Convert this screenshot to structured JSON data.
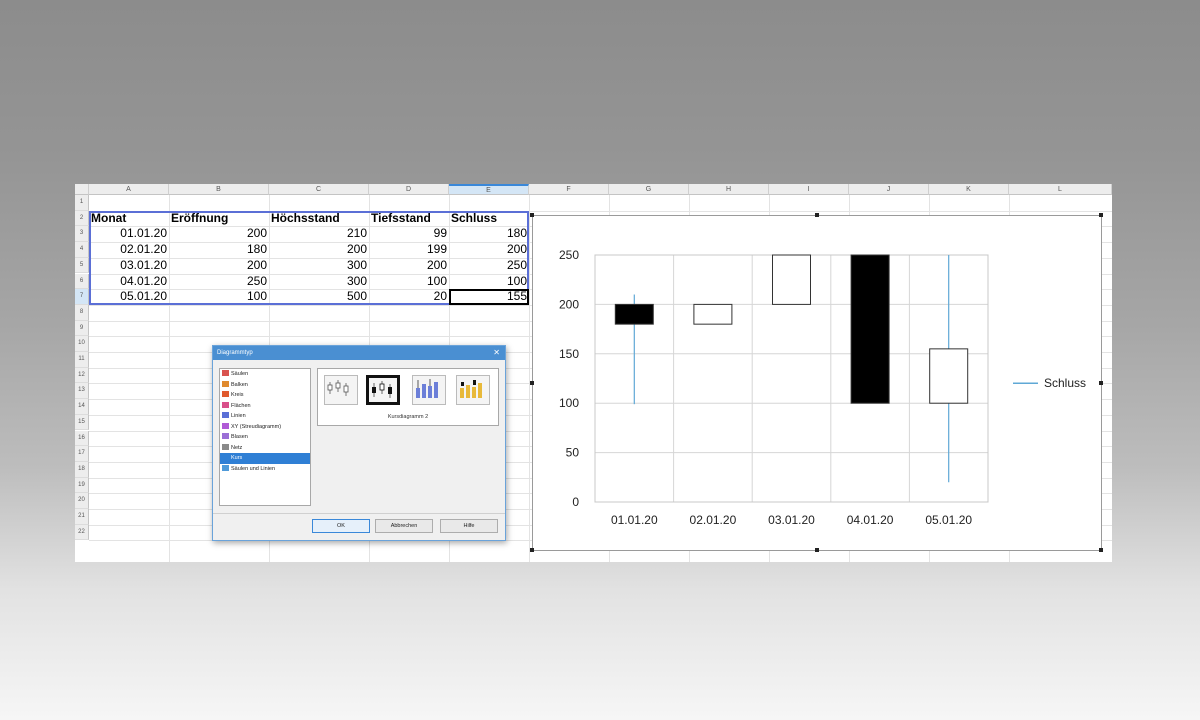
{
  "sheet": {
    "columns": [
      "A",
      "B",
      "C",
      "D",
      "E",
      "F",
      "G",
      "H",
      "I",
      "J",
      "K",
      "L"
    ],
    "selected_column": "E",
    "rows": [
      "1",
      "2",
      "3",
      "4",
      "5",
      "6",
      "7",
      "8",
      "9",
      "10",
      "11",
      "12",
      "13",
      "14",
      "15",
      "16",
      "17",
      "18",
      "19",
      "20",
      "21",
      "22"
    ],
    "headers": [
      "Monat",
      "Eröffnung",
      "Höchsstand",
      "Tiefsstand",
      "Schluss"
    ],
    "data": [
      [
        "01.01.20",
        "200",
        "210",
        "99",
        "180"
      ],
      [
        "02.01.20",
        "180",
        "200",
        "199",
        "200"
      ],
      [
        "03.01.20",
        "200",
        "300",
        "200",
        "250"
      ],
      [
        "04.01.20",
        "250",
        "300",
        "100",
        "100"
      ],
      [
        "05.01.20",
        "100",
        "500",
        "20",
        "155"
      ]
    ]
  },
  "dialog": {
    "title": "Diagrammtyp",
    "close_glyph": "✕",
    "chart_types": [
      "Säulen",
      "Balken",
      "Kreis",
      "Flächen",
      "Linien",
      "XY (Streudiagramm)",
      "Blasen",
      "Netz",
      "Kurs",
      "Säulen und Linien"
    ],
    "selected_type": "Kurs",
    "variant_label": "Kursdiagramm 2",
    "buttons": {
      "ok": "OK",
      "cancel": "Abbrechen",
      "help": "Hilfe"
    }
  },
  "chart_data": {
    "type": "candlestick",
    "categories": [
      "01.01.20",
      "02.01.20",
      "03.01.20",
      "04.01.20",
      "05.01.20"
    ],
    "series": [
      {
        "name": "Schluss",
        "open": [
          200,
          180,
          200,
          250,
          100
        ],
        "high": [
          210,
          200,
          300,
          300,
          500
        ],
        "low": [
          99,
          199,
          200,
          100,
          20
        ],
        "close": [
          180,
          200,
          250,
          100,
          155
        ]
      }
    ],
    "ylim": [
      0,
      250
    ],
    "yticks": [
      0,
      50,
      100,
      150,
      200,
      250
    ],
    "legend": "right",
    "grid": true,
    "colors": {
      "down_fill": "#000000",
      "up_fill": "#ffffff",
      "wick": "#5fa8d6"
    }
  }
}
